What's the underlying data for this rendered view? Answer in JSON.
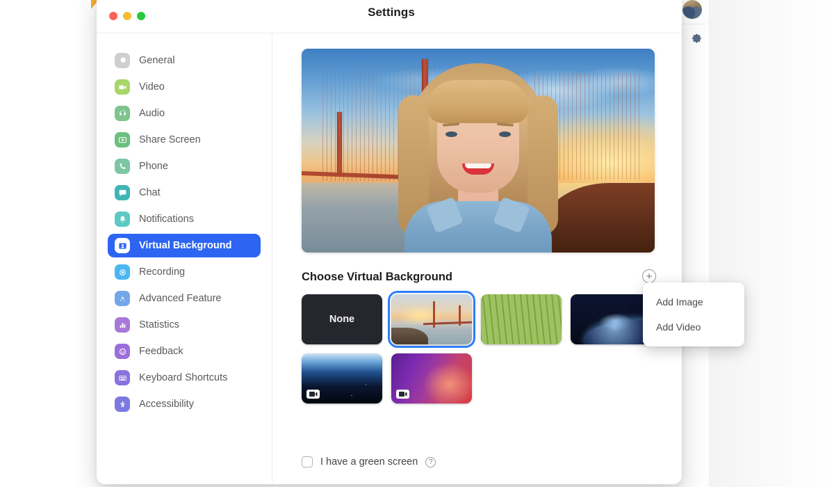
{
  "window": {
    "title": "Settings",
    "controls": [
      {
        "name": "close",
        "color": "#ff5f57"
      },
      {
        "name": "minimize",
        "color": "#f7bd2e"
      },
      {
        "name": "zoom",
        "color": "#2ac940"
      }
    ]
  },
  "sidebar": {
    "items": [
      {
        "label": "General",
        "icon": "gear-icon",
        "color": "#cfcfcf",
        "active": false
      },
      {
        "label": "Video",
        "icon": "video-camera-icon",
        "color": "#a9d668",
        "active": false
      },
      {
        "label": "Audio",
        "icon": "headphones-icon",
        "color": "#7ec48d",
        "active": false
      },
      {
        "label": "Share Screen",
        "icon": "share-screen-icon",
        "color": "#6cbf7e",
        "active": false
      },
      {
        "label": "Phone",
        "icon": "phone-icon",
        "color": "#7cc6a3",
        "active": false
      },
      {
        "label": "Chat",
        "icon": "chat-bubble-icon",
        "color": "#3fb5b5",
        "active": false
      },
      {
        "label": "Notifications",
        "icon": "bell-icon",
        "color": "#5ec9c4",
        "active": false
      },
      {
        "label": "Virtual Background",
        "icon": "person-card-icon",
        "color": "#2d65f2",
        "active": true
      },
      {
        "label": "Recording",
        "icon": "record-circle-icon",
        "color": "#49b6f0",
        "active": false
      },
      {
        "label": "Advanced Feature",
        "icon": "sparkle-icon",
        "color": "#74a6ea",
        "active": false
      },
      {
        "label": "Statistics",
        "icon": "bar-chart-icon",
        "color": "#a878d8",
        "active": false
      },
      {
        "label": "Feedback",
        "icon": "smiley-face-icon",
        "color": "#9b6fdb",
        "active": false
      },
      {
        "label": "Keyboard Shortcuts",
        "icon": "keyboard-icon",
        "color": "#8a73de",
        "active": false
      },
      {
        "label": "Accessibility",
        "icon": "accessibility-icon",
        "color": "#7b79e0",
        "active": false
      }
    ]
  },
  "main": {
    "preview": {
      "alt": "video-preview-with-virtual-background"
    },
    "choose_title": "Choose Virtual Background",
    "add_button": "+",
    "backgrounds": [
      {
        "label": "None",
        "style": "none",
        "selected": false,
        "is_video": false
      },
      {
        "label": "",
        "style": "bridge",
        "selected": true,
        "is_video": false
      },
      {
        "label": "",
        "style": "grass",
        "selected": false,
        "is_video": false
      },
      {
        "label": "",
        "style": "space",
        "selected": false,
        "is_video": false
      },
      {
        "label": "",
        "style": "earth",
        "selected": false,
        "is_video": true
      },
      {
        "label": "",
        "style": "aurora",
        "selected": false,
        "is_video": true
      }
    ],
    "green_screen": {
      "label": "I have a green screen",
      "checked": false,
      "help": "?"
    }
  },
  "add_menu": {
    "items": [
      {
        "label": "Add Image"
      },
      {
        "label": "Add Video"
      }
    ]
  },
  "background_app": {
    "small_text": "● ▪ ▪ ▪ ▪ ▪ ▪ ▪",
    "gear": "gear-icon",
    "avatar": "user-avatar"
  },
  "colors": {
    "accent": "#2d65f2",
    "selection_ring": "#2d7dfa",
    "modal_bg": "#ffffff",
    "label_text": "#5a5a5a"
  }
}
